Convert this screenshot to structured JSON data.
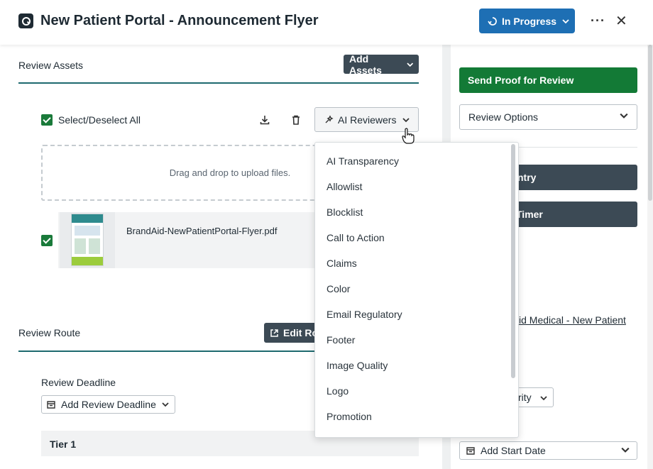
{
  "header": {
    "title": "New Patient Portal - Announcement Flyer",
    "status_label": "In Progress",
    "more_label": "···",
    "close_label": "✕"
  },
  "review_assets": {
    "title": "Review Assets",
    "add_assets_label": "Add Assets",
    "select_all_label": "Select/Deselect All",
    "ai_reviewers_label": "AI Reviewers",
    "dropzone_text": "Drag and drop to upload files.",
    "file_name": "BrandAid-NewPatientPortal-Flyer.pdf"
  },
  "review_route": {
    "title": "Review Route",
    "edit_label": "Edit Ro",
    "deadline_label": "Review Deadline",
    "add_deadline_label": "Add Review Deadline",
    "tier_label": "Tier 1"
  },
  "sidebar": {
    "send_proof_label": "Send Proof for Review",
    "review_options_label": "Review Options",
    "btn1_partial": "ntry",
    "btn2_partial": "Timer",
    "link_partial": "id Medical - New Patient",
    "priority_partial": "rity",
    "start_date_label": "Add Start Date"
  },
  "ai_menu": {
    "items": [
      "AI Transparency",
      "Allowlist",
      "Blocklist",
      "Call to Action",
      "Claims",
      "Color",
      "Email Regulatory",
      "Footer",
      "Image Quality",
      "Logo",
      "Promotion"
    ]
  },
  "colors": {
    "primary_blue": "#1e6fb4",
    "dark_button": "#3c4a55",
    "green": "#137a36",
    "teal_rule": "#1e6a6f"
  }
}
